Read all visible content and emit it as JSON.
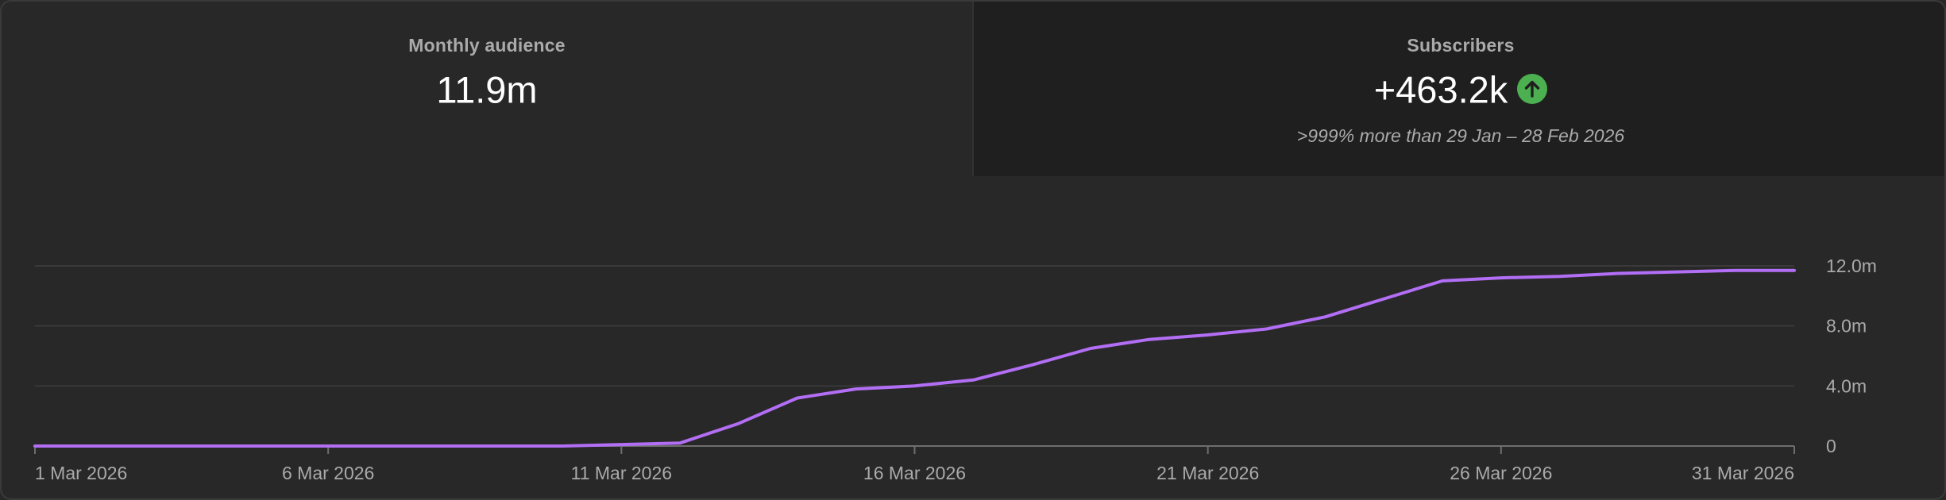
{
  "cards": [
    {
      "label": "Monthly audience",
      "value": "11.9m"
    },
    {
      "label": "Subscribers",
      "value": "+463.2k",
      "trend_icon": "arrow-up-icon",
      "trend_color": "#4caf50",
      "comparison": ">999% more than 29 Jan – 28 Feb 2026"
    }
  ],
  "chart_data": {
    "type": "line",
    "line_color": "#b26ef5",
    "x": [
      "1 Mar 2026",
      "2 Mar 2026",
      "3 Mar 2026",
      "4 Mar 2026",
      "5 Mar 2026",
      "6 Mar 2026",
      "7 Mar 2026",
      "8 Mar 2026",
      "9 Mar 2026",
      "10 Mar 2026",
      "11 Mar 2026",
      "12 Mar 2026",
      "13 Mar 2026",
      "14 Mar 2026",
      "15 Mar 2026",
      "16 Mar 2026",
      "17 Mar 2026",
      "18 Mar 2026",
      "19 Mar 2026",
      "20 Mar 2026",
      "21 Mar 2026",
      "22 Mar 2026",
      "23 Mar 2026",
      "24 Mar 2026",
      "25 Mar 2026",
      "26 Mar 2026",
      "27 Mar 2026",
      "28 Mar 2026",
      "29 Mar 2026",
      "30 Mar 2026",
      "31 Mar 2026"
    ],
    "values": [
      0,
      0,
      0,
      0,
      0,
      0,
      0,
      0,
      0,
      0,
      0.1,
      0.2,
      1.5,
      3.2,
      3.8,
      4.0,
      4.4,
      5.4,
      6.5,
      7.1,
      7.4,
      7.8,
      8.6,
      9.8,
      11.0,
      11.2,
      11.3,
      11.5,
      11.6,
      11.7,
      11.7
    ],
    "x_tick_labels": [
      "1 Mar 2026",
      "6 Mar 2026",
      "11 Mar 2026",
      "16 Mar 2026",
      "21 Mar 2026",
      "26 Mar 2026",
      "31 Mar 2026"
    ],
    "y_tick_labels": [
      "0",
      "4.0m",
      "8.0m",
      "12.0m"
    ],
    "y_ticks": [
      0,
      4,
      8,
      12
    ],
    "ylim": [
      0,
      12
    ],
    "grid": true,
    "y_axis_side": "right"
  }
}
